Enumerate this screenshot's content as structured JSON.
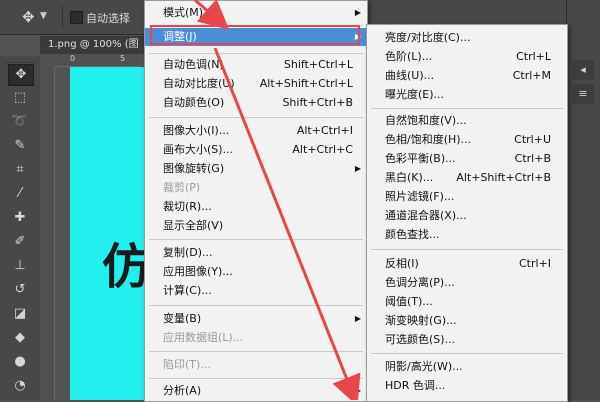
{
  "options_bar": {
    "auto_select_label": "自动选择"
  },
  "document": {
    "tab_title": "1.png @ 100% (图",
    "ruler_ticks": [
      "0",
      "5"
    ],
    "canvas_text": "仿"
  },
  "main_menu": {
    "items": [
      {
        "label": "模式(M)",
        "submenu": true
      },
      {
        "label": "调整(J)",
        "submenu": true,
        "highlight": true
      },
      {
        "label": "自动色调(N)",
        "shortcut": "Shift+Ctrl+L"
      },
      {
        "label": "自动对比度(U)",
        "shortcut": "Alt+Shift+Ctrl+L"
      },
      {
        "label": "自动颜色(O)",
        "shortcut": "Shift+Ctrl+B"
      },
      {
        "label": "图像大小(I)...",
        "shortcut": "Alt+Ctrl+I"
      },
      {
        "label": "画布大小(S)...",
        "shortcut": "Alt+Ctrl+C"
      },
      {
        "label": "图像旋转(G)",
        "submenu": true
      },
      {
        "label": "裁剪(P)",
        "disabled": true
      },
      {
        "label": "裁切(R)..."
      },
      {
        "label": "显示全部(V)"
      },
      {
        "label": "复制(D)..."
      },
      {
        "label": "应用图像(Y)..."
      },
      {
        "label": "计算(C)..."
      },
      {
        "label": "变量(B)",
        "submenu": true
      },
      {
        "label": "应用数据组(L)...",
        "disabled": true
      },
      {
        "label": "陷印(T)...",
        "disabled": true
      },
      {
        "label": "分析(A)",
        "submenu": true
      }
    ]
  },
  "adjust_submenu": {
    "items": [
      {
        "label": "亮度/对比度(C)..."
      },
      {
        "label": "色阶(L)...",
        "shortcut": "Ctrl+L"
      },
      {
        "label": "曲线(U)...",
        "shortcut": "Ctrl+M"
      },
      {
        "label": "曝光度(E)..."
      },
      {
        "label": "自然饱和度(V)..."
      },
      {
        "label": "色相/饱和度(H)...",
        "shortcut": "Ctrl+U"
      },
      {
        "label": "色彩平衡(B)...",
        "shortcut": "Ctrl+B"
      },
      {
        "label": "黑白(K)...",
        "shortcut": "Alt+Shift+Ctrl+B"
      },
      {
        "label": "照片滤镜(F)..."
      },
      {
        "label": "通道混合器(X)..."
      },
      {
        "label": "颜色查找..."
      },
      {
        "label": "反相(I)",
        "shortcut": "Ctrl+I"
      },
      {
        "label": "色调分离(P)..."
      },
      {
        "label": "阈值(T)..."
      },
      {
        "label": "渐变映射(G)..."
      },
      {
        "label": "可选颜色(S)..."
      },
      {
        "label": "阴影/高光(W)..."
      },
      {
        "label": "HDR 色调..."
      }
    ]
  },
  "colors": {
    "annotation_red": "#e8464c",
    "highlight_blue": "#4a8fd6",
    "canvas_cyan": "#21f0ee"
  }
}
